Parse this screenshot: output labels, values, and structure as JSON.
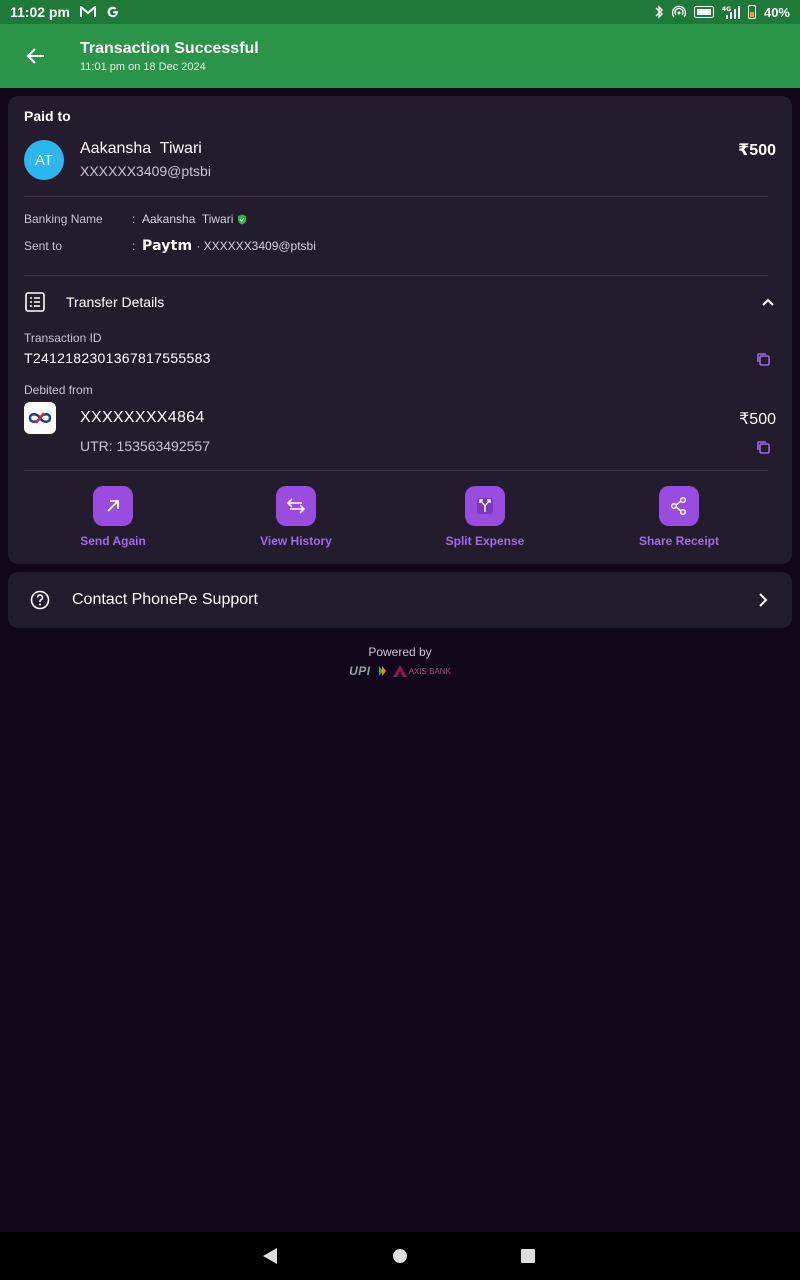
{
  "status_bar": {
    "time": "11:02 pm",
    "battery": "40%",
    "net_label": "4G"
  },
  "header": {
    "title": "Transaction Successful",
    "subtitle": "11:01 pm on 18 Dec 2024",
    "background": "#2a9449"
  },
  "paid_to": {
    "label": "Paid to",
    "initials": "AT",
    "name": "Aakansha  Tiwari",
    "vpa": "XXXXXX3409@ptsbi",
    "amount": "₹500"
  },
  "details": {
    "banking_name_label": "Banking Name",
    "banking_name_value": "Aakansha  Tiwari",
    "sent_to_label": "Sent to",
    "sent_to_brand": "Paytm",
    "sent_to_value": "· XXXXXX3409@ptsbi",
    "colon": ":"
  },
  "transfer": {
    "title": "Transfer Details",
    "txn_id_label": "Transaction ID",
    "txn_id": "T2412182301367817555583",
    "debited_from_label": "Debited from",
    "account": "XXXXXXXX4864",
    "amount": "₹500",
    "utr": "UTR: 153563492557"
  },
  "actions": [
    {
      "label": "Send Again",
      "icon": "arrow-up-right-icon"
    },
    {
      "label": "View History",
      "icon": "swap-arrows-icon"
    },
    {
      "label": "Split Expense",
      "icon": "split-icon"
    },
    {
      "label": "Share Receipt",
      "icon": "share-icon"
    }
  ],
  "support": {
    "label": "Contact PhonePe Support"
  },
  "footer": {
    "powered_by": "Powered by",
    "upi": "UPI",
    "bank": "AXIS BANK"
  },
  "colors": {
    "accent": "#9a4ce0",
    "accent_text": "#a567ec",
    "card": "#221c2c",
    "background": "#12071a"
  }
}
